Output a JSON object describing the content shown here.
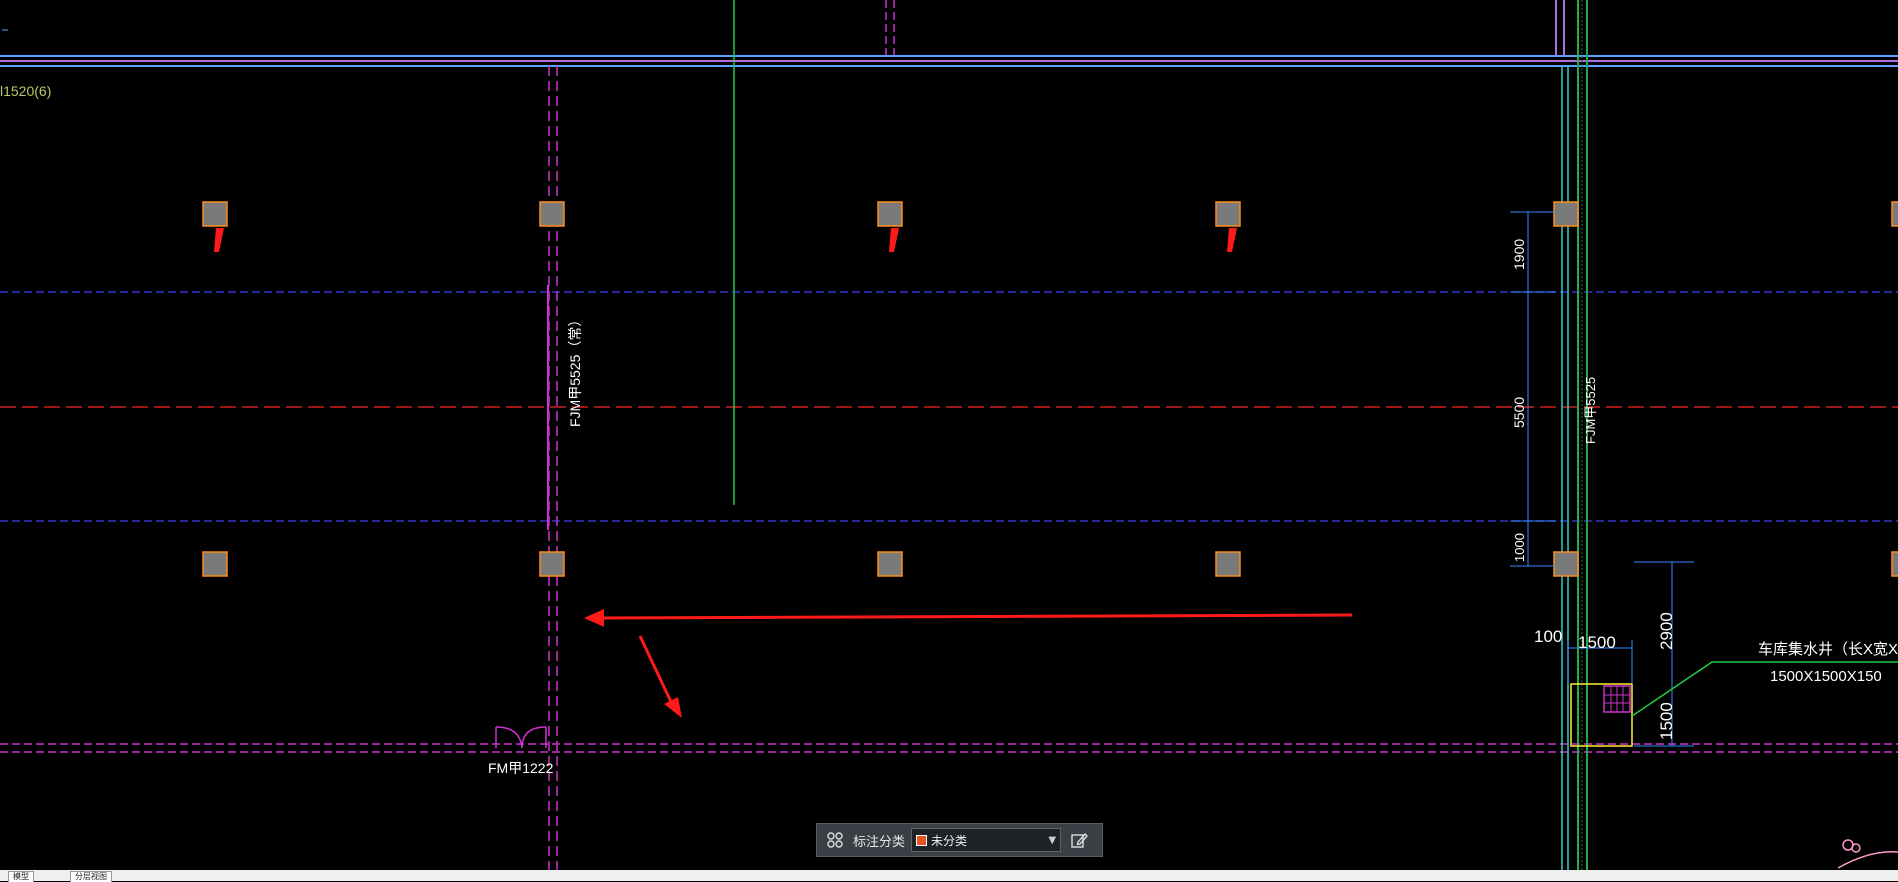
{
  "drawing": {
    "top_left_label": "l1520(6)",
    "door_labels": {
      "fjm_left": "FJM甲5525（常）",
      "fjm_right": "FJM甲5525",
      "fm": "FM甲1222"
    },
    "dimensions": {
      "d1900": "1900",
      "d5500": "5500",
      "d1000": "1000",
      "d100": "100",
      "d1500_top": "1500",
      "d2900": "2900",
      "d1500_side": "1500"
    },
    "sump_label_line1": "车库集水井（长X宽X深",
    "sump_label_line2": "1500X1500X150"
  },
  "toolbar": {
    "label": "标注分类",
    "selected": "未分类",
    "swatch_color": "#e8551f",
    "left_icon": "grid-icon",
    "right_icon": "edit-icon"
  },
  "bottom_tabs": {
    "tab1": "模型",
    "tab2": "分层视图"
  }
}
